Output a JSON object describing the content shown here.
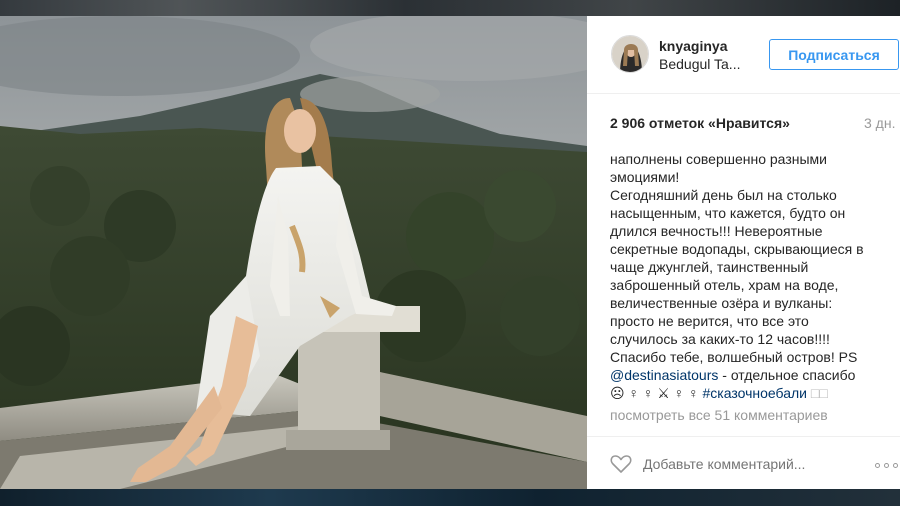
{
  "post": {
    "username": "knyaginya",
    "location": "Bedugul Ta...",
    "follow_label": "Подписаться",
    "likes": "2 906 отметок «Нравится»",
    "time": "3 дн.",
    "caption_lines": [
      "наполнены совершенно разными",
      "эмоциями!",
      "Сегодняшний день был на столько",
      "насыщенным, что кажется, будто он",
      "длился вечность!!! Невероятные",
      "секретные водопады, скрывающиеся в",
      "чаще джунглей, таинственный",
      "заброшенный отель, храм на воде,",
      "величественные озёра и вулканы:",
      "просто не верится, что все это",
      "случилось за каких-то 12 часов!!!!",
      "Спасибо тебе, волшебный остров! PS"
    ],
    "mention": "@destinasiatours",
    "mention_suffix": " - отдельное спасибо",
    "emoji_text": "☹ ♀ ♀ ⚔ ♀ ♀",
    "hashtag": "#сказочноебали",
    "hashtag_suffix": " □□",
    "view_comments": "посмотреть все 51 комментариев",
    "comment_placeholder": "Добавьте комментарий...",
    "icons": {
      "like": "heart-icon",
      "more": "more-options-icon"
    },
    "colors": {
      "accent": "#3897f0",
      "link": "#003569",
      "muted": "#999999",
      "text": "#262626"
    }
  }
}
